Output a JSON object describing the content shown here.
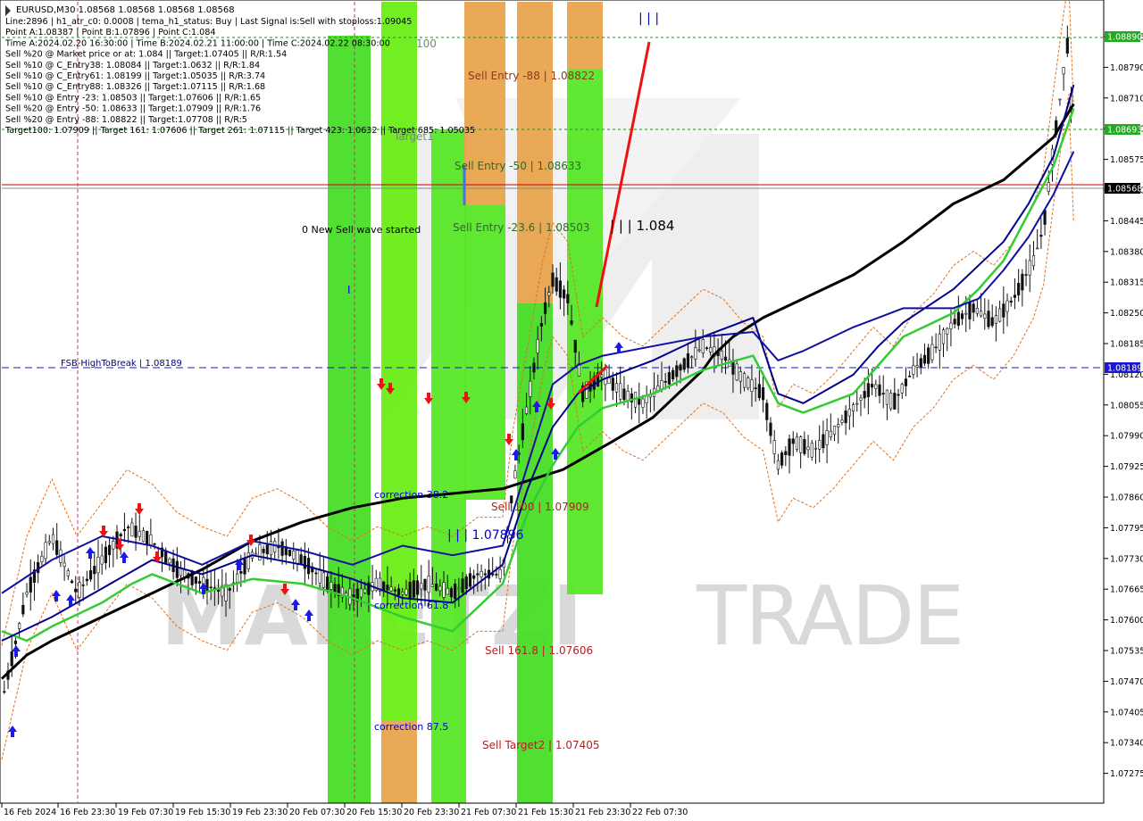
{
  "chart_data": {
    "type": "line",
    "title": "EURUSD,M30",
    "symbol": "EURUSD",
    "timeframe": "M30",
    "ohlc_text": "1.08568 1.08568 1.08568 1.08568",
    "grid": false,
    "ylim": [
      1.0724,
      1.08925
    ],
    "y_ticks": [
      "1.08855",
      "1.08790",
      "1.08710",
      "1.08640",
      "1.08575",
      "1.08510",
      "1.08445",
      "1.08380",
      "1.08315",
      "1.08250",
      "1.08185",
      "1.08120",
      "1.08055",
      "1.07990",
      "1.07925",
      "1.07860",
      "1.07795",
      "1.07730",
      "1.07665",
      "1.07600",
      "1.07535",
      "1.07470",
      "1.07405",
      "1.07340",
      "1.07275"
    ],
    "x_ticks": [
      "16 Feb 2024",
      "16 Feb 23:30",
      "19 Feb 07:30",
      "19 Feb 15:30",
      "19 Feb 23:30",
      "20 Feb 07:30",
      "20 Feb 15:30",
      "20 Feb 23:30",
      "21 Feb 07:30",
      "21 Feb 15:30",
      "21 Feb 23:30",
      "22 Feb 07:30"
    ],
    "info_lines": [
      "Line:2896 | h1_atr_c0: 0.0008 | tema_h1_status: Buy | Last Signal is:Sell with stoploss:1.09045",
      "Point A:1.08387 | Point B:1.07896 | Point C:1.084",
      "Time A:2024.02.20 16:30:00 | Time B:2024.02.21 11:00:00 | Time C:2024.02.22 08:30:00",
      "Sell %20 @ Market price or at: 1.084 || Target:1.07405 || R/R:1.54",
      "Sell %10 @ C_Entry38: 1.08084 || Target:1.0632 || R/R:1.84",
      "Sell %10 @ C_Entry61: 1.08199 || Target:1.05035 || R/R:3.74",
      "Sell %10 @ C_Entry88: 1.08326 || Target:1.07115 || R/R:1.68",
      "Sell %10 @ Entry -23: 1.08503 || Target:1.07606 || R/R:1.65",
      "Sell %20 @ Entry -50: 1.08633 || Target:1.07909 || R/R:1.76",
      "Sell %20 @ Entry -88: 1.08822 || Target:1.07708 || R/R:5",
      "Target100: 1.07909 || Target 161: 1.07606 || Target 261: 1.07115 || Target 423: 1.0632 || Target 685: 1.05035"
    ],
    "price_tags": [
      {
        "value": "1.08890",
        "kind": "green"
      },
      {
        "value": "1.08693",
        "kind": "green"
      },
      {
        "value": "1.08568",
        "kind": "black"
      },
      {
        "value": "1.08189",
        "kind": "blue"
      }
    ],
    "annotations": [
      {
        "text": "Sell Entry -88 | 1.08822",
        "color": "#8b3a1a"
      },
      {
        "text": "Sell Entry -50 | 1.08633",
        "color": "#2d6b2d"
      },
      {
        "text": "Sell Entry -23.6 | 1.08503",
        "color": "#2d6b2d"
      },
      {
        "text": "0 New Sell wave started",
        "color": "#000000"
      },
      {
        "text": "FSB-HighToBreak | 1.08189",
        "color": "#000080"
      },
      {
        "text": "correction 38.2",
        "color": "#0000cc"
      },
      {
        "text": "correction 61.8",
        "color": "#0000cc"
      },
      {
        "text": "correction 87.5",
        "color": "#0000cc"
      },
      {
        "text": "Sell 100 | 1.07909",
        "color": "#b22222"
      },
      {
        "text": "Sell 161.8 | 1.07606",
        "color": "#b22222"
      },
      {
        "text": "Sell Target2 | 1.07405",
        "color": "#b22222"
      },
      {
        "text": "| | | 1.07896",
        "color": "#0000cc"
      },
      {
        "text": "| | | 1.084",
        "color": "#000000"
      },
      {
        "text": "Target1",
        "color": "#6b8e6b"
      },
      {
        "text": "100",
        "color": "#6b8e6b"
      },
      {
        "text": "| | |",
        "color": "#0000cc"
      },
      {
        "text": "I",
        "color": "#0000cc"
      }
    ],
    "watermark": "MAKETZI TRADE",
    "series": [
      {
        "key": "ma_black",
        "color": "#000000",
        "x": [
          0,
          5,
          10,
          20,
          30,
          40,
          50,
          60,
          70,
          80,
          90,
          100,
          112,
          122,
          130,
          135,
          140,
          142,
          146,
          152,
          160,
          170,
          180,
          190,
          200,
          210,
          214
        ],
        "y": [
          1.075,
          1.0755,
          1.0758,
          1.0763,
          1.0768,
          1.0773,
          1.0779,
          1.0783,
          1.0786,
          1.0788,
          1.0789,
          1.079,
          1.0794,
          1.08,
          1.0805,
          1.081,
          1.0815,
          1.0818,
          1.0822,
          1.0826,
          1.083,
          1.0835,
          1.0842,
          1.085,
          1.0855,
          1.0864,
          1.0871
        ]
      },
      {
        "key": "ma_green",
        "color": "#33cc33",
        "x": [
          0,
          5,
          10,
          20,
          26,
          30,
          40,
          50,
          60,
          70,
          80,
          90,
          100,
          105,
          110,
          115,
          120,
          130,
          140,
          150,
          155,
          160,
          170,
          175,
          180,
          190,
          195,
          200,
          205,
          210,
          214
        ],
        "y": [
          1.076,
          1.0758,
          1.0761,
          1.0766,
          1.077,
          1.0772,
          1.0768,
          1.0771,
          1.077,
          1.0767,
          1.0763,
          1.076,
          1.077,
          1.0785,
          1.0795,
          1.0803,
          1.0807,
          1.081,
          1.0815,
          1.0818,
          1.0808,
          1.0806,
          1.081,
          1.0816,
          1.0822,
          1.0827,
          1.0832,
          1.0838,
          1.0848,
          1.0858,
          1.087
        ]
      },
      {
        "key": "ma_navy",
        "color": "#00008b",
        "x": [
          0,
          10,
          20,
          25,
          30,
          40,
          50,
          60,
          70,
          80,
          90,
          100,
          105,
          110,
          115,
          120,
          130,
          140,
          150,
          155,
          160,
          170,
          175,
          180,
          190,
          195,
          200,
          205,
          210,
          214
        ],
        "y": [
          1.0758,
          1.0763,
          1.0769,
          1.0772,
          1.0775,
          1.0772,
          1.0776,
          1.0774,
          1.0771,
          1.0767,
          1.0766,
          1.0774,
          1.079,
          1.0803,
          1.081,
          1.0813,
          1.0817,
          1.0822,
          1.0826,
          1.081,
          1.0808,
          1.0814,
          1.082,
          1.0825,
          1.0832,
          1.0837,
          1.0842,
          1.085,
          1.086,
          1.0875
        ]
      },
      {
        "key": "ma_blue",
        "color": "#1010a0",
        "x": [
          0,
          10,
          20,
          30,
          40,
          50,
          60,
          70,
          80,
          90,
          100,
          105,
          110,
          115,
          120,
          130,
          140,
          150,
          155,
          160,
          170,
          175,
          180,
          190,
          195,
          200,
          205,
          210,
          214
        ],
        "y": [
          1.0768,
          1.0775,
          1.078,
          1.0778,
          1.0774,
          1.0779,
          1.0777,
          1.0774,
          1.0778,
          1.0776,
          1.0778,
          1.0795,
          1.0812,
          1.0816,
          1.0818,
          1.082,
          1.0822,
          1.0823,
          1.0817,
          1.0819,
          1.0824,
          1.0826,
          1.0828,
          1.0828,
          1.083,
          1.0836,
          1.0843,
          1.0852,
          1.0861
        ]
      },
      {
        "key": "price_path",
        "color": "#333333",
        "x": [
          0,
          5,
          10,
          15,
          20,
          25,
          30,
          35,
          40,
          45,
          50,
          55,
          60,
          65,
          70,
          75,
          80,
          85,
          90,
          95,
          100,
          102,
          105,
          108,
          110,
          113,
          116,
          120,
          124,
          128,
          132,
          136,
          140,
          144,
          148,
          152,
          155,
          158,
          162,
          166,
          170,
          174,
          178,
          182,
          186,
          190,
          194,
          198,
          202,
          206,
          208,
          210,
          212,
          213,
          214
        ],
        "y": [
          1.0745,
          1.0768,
          1.078,
          1.0768,
          1.0775,
          1.0782,
          1.0779,
          1.0773,
          1.077,
          1.0768,
          1.0776,
          1.0778,
          1.0775,
          1.077,
          1.0767,
          1.077,
          1.0768,
          1.077,
          1.0768,
          1.0772,
          1.0772,
          1.079,
          1.0808,
          1.0826,
          1.0834,
          1.083,
          1.081,
          1.0814,
          1.081,
          1.0808,
          1.0812,
          1.0816,
          1.082,
          1.0818,
          1.0813,
          1.081,
          1.0795,
          1.08,
          1.0798,
          1.0802,
          1.0807,
          1.0812,
          1.0808,
          1.0815,
          1.0819,
          1.0825,
          1.0828,
          1.0825,
          1.083,
          1.0838,
          1.0845,
          1.0862,
          1.0878,
          1.0885,
          1.0858
        ]
      }
    ]
  }
}
